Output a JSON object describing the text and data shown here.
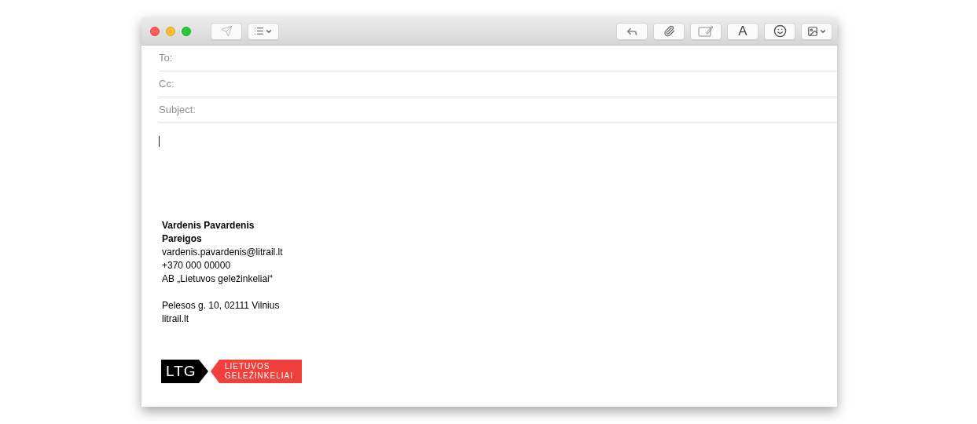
{
  "toolbar": {
    "send": {
      "disabled": true
    },
    "format_button": {
      "label": "A"
    }
  },
  "fields": [
    {
      "label": "To:"
    },
    {
      "label": "Cc:"
    },
    {
      "label": "Subject:"
    }
  ],
  "signature": {
    "blocks": [
      [
        {
          "text": "Vardenis Pavardenis",
          "bold": true
        },
        {
          "text": "Pareigos",
          "bold": true
        },
        {
          "text": "vardenis.pavardenis@litrail.lt",
          "bold": false
        },
        {
          "text": "+370 000 00000",
          "bold": false
        },
        {
          "text": "AB „Lietuvos geležinkeliai“",
          "bold": false
        }
      ],
      [
        {
          "text": "Pelesos g. 10, 02111 Vilnius",
          "bold": false
        },
        {
          "text": "litrail.lt",
          "bold": false
        }
      ]
    ]
  },
  "logo": {
    "mark": "LTG",
    "name_lines": [
      "LIETUVOS",
      "GELEŽINKELIAI"
    ]
  }
}
